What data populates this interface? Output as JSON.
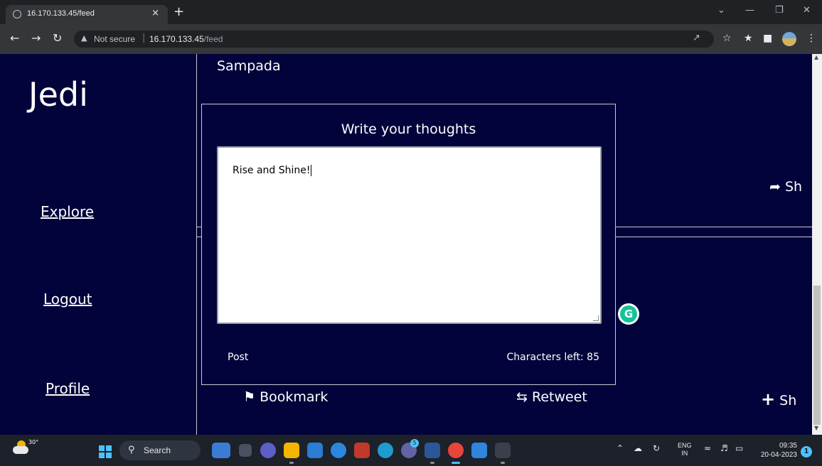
{
  "browser": {
    "tab_title": "16.170.133.45/feed",
    "tab_close": "×",
    "new_tab": "+",
    "security_label": "Not secure",
    "url_host": "16.170.133.45",
    "url_path": "/feed",
    "icons": [
      "back-icon",
      "forward-icon",
      "reload-icon",
      "warning-icon",
      "share-icon",
      "star-icon",
      "extensions-icon",
      "sidepanel-icon",
      "profile-icon",
      "menu-icon"
    ]
  },
  "sidebar": {
    "brand": "Jedi",
    "items": [
      {
        "label": "Explore"
      },
      {
        "label": "Logout"
      },
      {
        "label": "Profile"
      }
    ]
  },
  "feed": {
    "author": "Sampada",
    "share_label": "Sh",
    "bookmark_label": "Bookmark",
    "retweet_label": "Retweet",
    "share_label_2": "Sh"
  },
  "modal": {
    "title": "Write your thoughts",
    "textarea_value": "Rise and Shine!",
    "post_label": "Post",
    "chars_left": "Characters left: 85"
  },
  "taskbar": {
    "weather_temp": "30°",
    "search_label": "Search",
    "lang_top": "ENG",
    "lang_bottom": "IN",
    "time": "09:35",
    "date": "20-04-2023",
    "teams_badge": "5"
  },
  "colors": {
    "page_bg": "#02033b",
    "grammarly": "#15c39a",
    "accent": "#4cc2ff"
  }
}
